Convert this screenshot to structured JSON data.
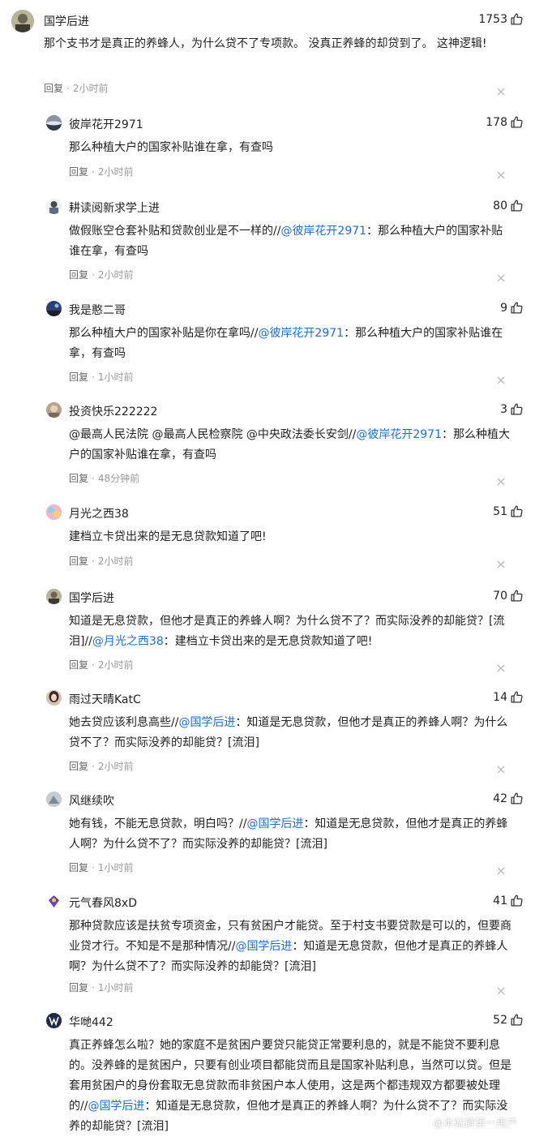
{
  "icons": {
    "like": "thumbs-up-icon",
    "dismiss": "close-icon"
  },
  "colors": {
    "mention": "#1a6fe0",
    "text": "#222222",
    "meta": "#999999"
  },
  "reply_label": "回复",
  "comments": [
    {
      "user": "国学后进",
      "likes": "1753",
      "segments": [
        {
          "text": "那个支书才是真正的养蜂人，为什么贷不了专项款。 没真正养蜂的却贷到了。 这神逻辑!"
        }
      ],
      "time": "2小时前"
    },
    {
      "user": "彼岸花开2971",
      "likes": "178",
      "segments": [
        {
          "text": "那么种植大户的国家补贴谁在拿，有查吗"
        }
      ],
      "time": "2小时前"
    },
    {
      "user": "耕读阅新求学上进",
      "likes": "80",
      "segments": [
        {
          "text": "做假账空仓套补贴和贷款创业是不一样的//"
        },
        {
          "text": "@彼岸花开2971",
          "mention": true
        },
        {
          "text": "：那么种植大户的国家补贴谁在拿，有查吗"
        }
      ],
      "time": "2小时前"
    },
    {
      "user": "我是憨二哥",
      "likes": "9",
      "segments": [
        {
          "text": "那么种植大户的国家补贴是你在拿吗//"
        },
        {
          "text": "@彼岸花开2971",
          "mention": true
        },
        {
          "text": "：那么种植大户的国家补贴谁在拿，有查吗"
        }
      ],
      "time": "1小时前"
    },
    {
      "user": "投资快乐222222",
      "likes": "3",
      "segments": [
        {
          "text": "@最高人民法院 @最高人民检察院 @中央政法委长安剑//"
        },
        {
          "text": "@彼岸花开2971",
          "mention": true
        },
        {
          "text": "：那么种植大户的国家补贴谁在拿，有查吗"
        }
      ],
      "time": "48分钟前"
    },
    {
      "user": "月光之西38",
      "likes": "51",
      "segments": [
        {
          "text": "建档立卡贷出来的是无息贷款知道了吧!"
        }
      ],
      "time": "2小时前"
    },
    {
      "user": "国学后进",
      "likes": "70",
      "segments": [
        {
          "text": "知道是无息贷款，但他才是真正的养蜂人啊？为什么贷不了？而实际没养的却能贷？[流泪]//"
        },
        {
          "text": "@月光之西38",
          "mention": true
        },
        {
          "text": "：建档立卡贷出来的是无息贷款知道了吧!"
        }
      ],
      "time": "2小时前"
    },
    {
      "user": "雨过天晴KatC",
      "likes": "14",
      "segments": [
        {
          "text": "她去贷应该利息高些//"
        },
        {
          "text": "@国学后进",
          "mention": true
        },
        {
          "text": "：知道是无息贷款，但他才是真正的养蜂人啊？为什么贷不了？而实际没养的却能贷？[流泪]"
        }
      ],
      "time": "2小时前"
    },
    {
      "user": "风继续吹",
      "likes": "42",
      "segments": [
        {
          "text": "她有钱，不能无息贷款，明白吗？//"
        },
        {
          "text": "@国学后进",
          "mention": true
        },
        {
          "text": "：知道是无息贷款，但他才是真正的养蜂人啊？为什么贷不了？而实际没养的却能贷？[流泪]"
        }
      ],
      "time": "1小时前"
    },
    {
      "user": "元气春风8xD",
      "likes": "41",
      "segments": [
        {
          "text": "那种贷款应该是扶贫专项资金，只有贫困户才能贷。至于村支书要贷款是可以的，但要商业贷才行。不知是不是那种情况//"
        },
        {
          "text": "@国学后进",
          "mention": true
        },
        {
          "text": "：知道是无息贷款，但他才是真正的养蜂人啊？为什么贷不了？而实际没养的却能贷？[流泪]"
        }
      ],
      "time": "1小时前"
    },
    {
      "user": "华哋442",
      "likes": "52",
      "segments": [
        {
          "text": "真正养蜂怎么啦？她的家庭不是贫困户要贷只能贷正常要利息的，就是不能贷不要利息的。没养蜂的是贫困户，只要有创业项目都能贷而且是国家补贴利息，当然可以贷。但是套用贫困户的身份套取无息贷款而非贫困户本人使用，这是两个都违规双方都要被处理的//"
        },
        {
          "text": "@国学后进",
          "mention": true
        },
        {
          "text": "：知道是无息贷款，但他才是真正的养蜂人啊？为什么贷不了？而实际没养的却能贷？[流泪]"
        }
      ],
      "time": ""
    }
  ],
  "watermark": "@本站群第一用户"
}
